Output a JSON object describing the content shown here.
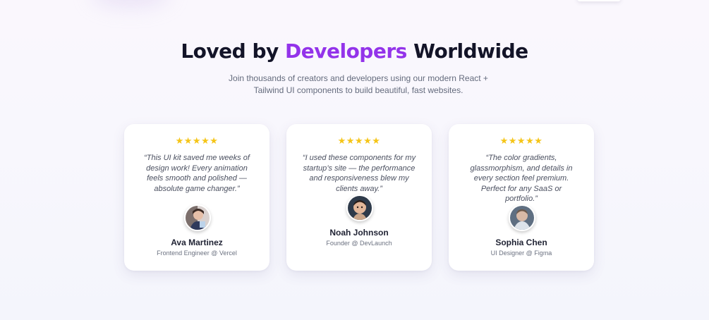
{
  "section": {
    "heading_prefix": "Loved by",
    "heading_accent": "Developers",
    "heading_suffix": "Worldwide",
    "subtitle": "Join thousands of creators and developers using our modern React + Tailwind UI components to build beautiful, fast websites.",
    "accent_color": "#9333ea",
    "star_color": "#f5c518"
  },
  "testimonials": [
    {
      "stars": "★★★★★",
      "rating": 5,
      "quote": "“This UI kit saved me weeks of design work! Every animation feels smooth and polished — absolute game changer.”",
      "name": "Ava Martinez",
      "role": "Frontend Engineer @ Vercel",
      "avatar_icon": "avatar-photo"
    },
    {
      "stars": "★★★★★",
      "rating": 5,
      "quote": "“I used these components for my startup’s site — the performance and responsiveness blew my clients away.”",
      "name": "Noah Johnson",
      "role": "Founder @ DevLaunch",
      "avatar_icon": "avatar-photo"
    },
    {
      "stars": "★★★★★",
      "rating": 5,
      "quote": "“The color gradients, glassmorphism, and details in every section feel premium. Perfect for any SaaS or portfolio.”",
      "name": "Sophia Chen",
      "role": "UI Designer @ Figma",
      "avatar_icon": "avatar-photo"
    }
  ]
}
